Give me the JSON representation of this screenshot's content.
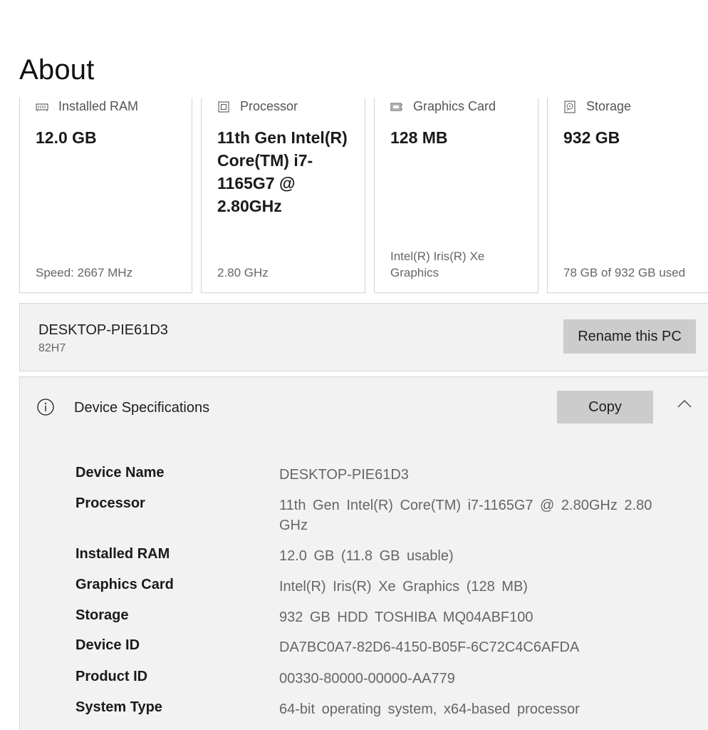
{
  "page": {
    "title": "About"
  },
  "cards": [
    {
      "label": "Installed RAM",
      "icon": "ram-icon",
      "value": "12.0 GB",
      "foot": "Speed: 2667 MHz"
    },
    {
      "label": "Processor",
      "icon": "processor-icon",
      "value": "11th Gen Intel(R) Core(TM) i7-1165G7 @ 2.80GHz",
      "foot": "2.80 GHz"
    },
    {
      "label": "Graphics Card",
      "icon": "graphics-card-icon",
      "value": "128 MB",
      "foot": "Intel(R) Iris(R) Xe Graphics"
    },
    {
      "label": "Storage",
      "icon": "storage-icon",
      "value": "932 GB",
      "foot": "78 GB of 932 GB used"
    }
  ],
  "device": {
    "name": "DESKTOP-PIE61D3",
    "model": "82H7",
    "rename_label": "Rename this PC"
  },
  "specs": {
    "title": "Device Specifications",
    "copy_label": "Copy",
    "rows": [
      {
        "label": "Device Name",
        "value": "DESKTOP-PIE61D3"
      },
      {
        "label": "Processor",
        "value": "11th Gen Intel(R) Core(TM) i7-1165G7 @ 2.80GHz   2.80 GHz"
      },
      {
        "label": "Installed RAM",
        "value": "12.0 GB (11.8 GB usable)"
      },
      {
        "label": "Graphics Card",
        "value": "Intel(R) Iris(R) Xe Graphics (128 MB)"
      },
      {
        "label": "Storage",
        "value": "932 GB HDD TOSHIBA MQ04ABF100"
      },
      {
        "label": "Device ID",
        "value": "DA7BC0A7-82D6-4150-B05F-6C72C4C6AFDA"
      },
      {
        "label": "Product ID",
        "value": "00330-80000-00000-AA779"
      },
      {
        "label": "System Type",
        "value": "64-bit operating system, x64-based processor"
      }
    ]
  }
}
